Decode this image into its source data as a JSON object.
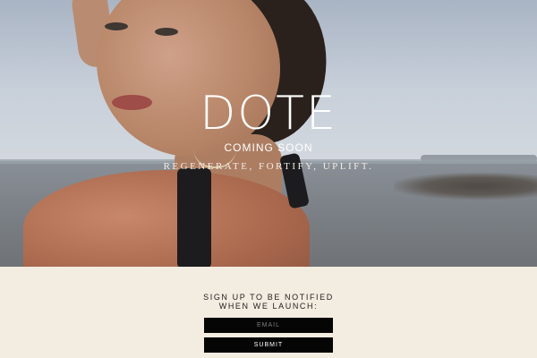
{
  "hero": {
    "brand": "DOTE",
    "coming_soon": "COMING SOON",
    "tagline": "REGENERATE, FORTIFY, UPLIFT."
  },
  "signup": {
    "title_line1": "SIGN UP TO BE NOTIFIED",
    "title_line2": "WHEN WE LAUNCH:",
    "email_placeholder": "EMAIL",
    "submit_label": "SUBMIT"
  },
  "colors": {
    "page_background": "#f3ece0",
    "field_background": "#050505"
  }
}
